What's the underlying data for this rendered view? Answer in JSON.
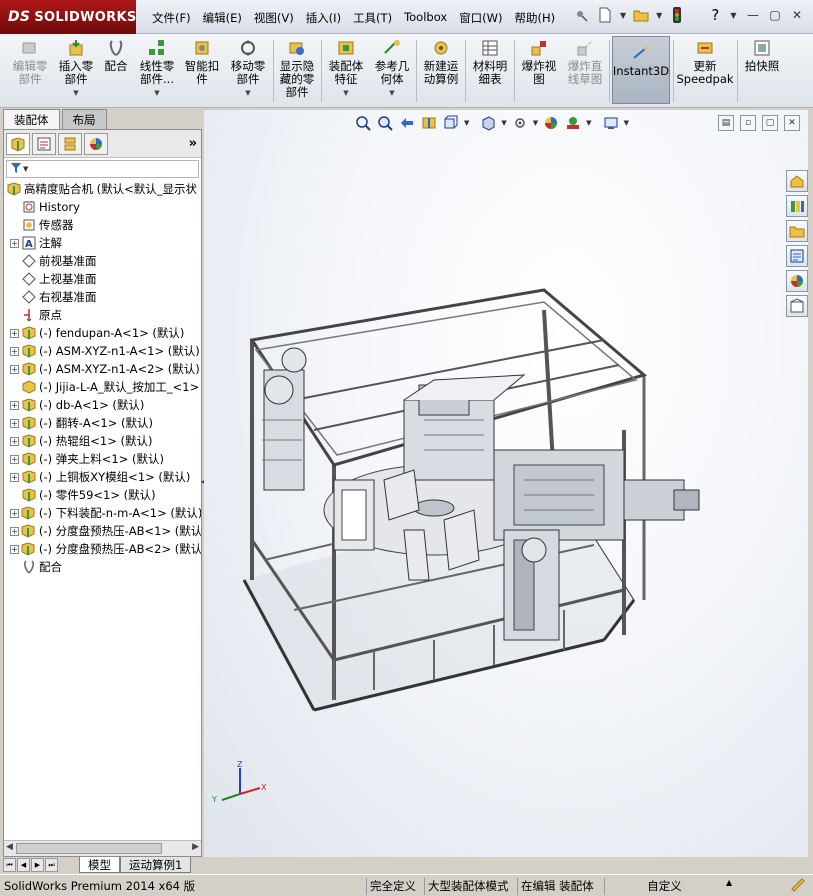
{
  "app": {
    "brand": "SOLIDWORKS",
    "brand_prefix": "DS"
  },
  "menu": [
    "文件(F)",
    "编辑(E)",
    "视图(V)",
    "插入(I)",
    "工具(T)",
    "Toolbox",
    "窗口(W)",
    "帮助(H)"
  ],
  "quick_access_icons": [
    "pin-icon",
    "new-document-icon",
    "open-folder-icon",
    "traffic-light-icon",
    "help-icon"
  ],
  "window_controls": [
    "minimize-icon",
    "restore-icon",
    "close-icon"
  ],
  "commands": [
    {
      "label": "编辑零\n部件",
      "icon": "edit-component-icon",
      "disabled": true,
      "dropdown": false
    },
    {
      "label": "插入零\n部件",
      "icon": "insert-component-icon",
      "disabled": false,
      "dropdown": true
    },
    {
      "label": "配合",
      "icon": "mate-icon",
      "disabled": false,
      "dropdown": false
    },
    {
      "label": "线性零\n部件...",
      "icon": "linear-pattern-icon",
      "disabled": false,
      "dropdown": true
    },
    {
      "label": "智能扣\n件",
      "icon": "smart-fastener-icon",
      "disabled": false,
      "dropdown": false
    },
    {
      "label": "移动零\n部件",
      "icon": "move-component-icon",
      "disabled": false,
      "dropdown": true
    },
    {
      "label": "显示隐\n藏的零\n部件",
      "icon": "show-hidden-icon",
      "disabled": false,
      "dropdown": false
    },
    {
      "label": "装配体\n特征",
      "icon": "assembly-feature-icon",
      "disabled": false,
      "dropdown": true
    },
    {
      "label": "参考几\n何体",
      "icon": "reference-geometry-icon",
      "disabled": false,
      "dropdown": true
    },
    {
      "label": "新建运\n动算例",
      "icon": "motion-study-icon",
      "disabled": false,
      "dropdown": false
    },
    {
      "label": "材料明\n细表",
      "icon": "bom-icon",
      "disabled": false,
      "dropdown": false
    },
    {
      "label": "爆炸视\n图",
      "icon": "exploded-view-icon",
      "disabled": false,
      "dropdown": false
    },
    {
      "label": "爆炸直\n线草图",
      "icon": "explode-line-sketch-icon",
      "disabled": true,
      "dropdown": false
    },
    {
      "label": "Instant3D",
      "icon": "instant3d-icon",
      "disabled": false,
      "dropdown": false
    },
    {
      "label": "更新\nSpeedpak",
      "icon": "speedpak-icon",
      "disabled": false,
      "dropdown": false
    },
    {
      "label": "拍快照",
      "icon": "snapshot-icon",
      "disabled": false,
      "dropdown": false
    }
  ],
  "left_tabs": [
    "装配体",
    "布局"
  ],
  "feature_tree": {
    "root": "高精度贴合机 (默认<默认_显示状",
    "nodes": [
      {
        "label": "History",
        "icon": "history-icon",
        "expand": "none"
      },
      {
        "label": "传感器",
        "icon": "sensor-icon",
        "expand": "none"
      },
      {
        "label": "注解",
        "icon": "annotation-icon",
        "expand": "+"
      },
      {
        "label": "前视基准面",
        "icon": "plane-icon",
        "expand": "none"
      },
      {
        "label": "上视基准面",
        "icon": "plane-icon",
        "expand": "none"
      },
      {
        "label": "右视基准面",
        "icon": "plane-icon",
        "expand": "none"
      },
      {
        "label": "原点",
        "icon": "origin-icon",
        "expand": "none"
      },
      {
        "label": "(-) fendupan-A<1> (默认)",
        "icon": "subassembly-icon",
        "expand": "+"
      },
      {
        "label": "(-) ASM-XYZ-n1-A<1> (默认)",
        "icon": "subassembly-icon",
        "expand": "+"
      },
      {
        "label": "(-) ASM-XYZ-n1-A<2> (默认)",
        "icon": "subassembly-icon",
        "expand": "+"
      },
      {
        "label": "(-) Jijia-L-A_默认_按加工_<1>",
        "icon": "part-icon",
        "expand": "none"
      },
      {
        "label": "(-) db-A<1> (默认)",
        "icon": "subassembly-icon",
        "expand": "+"
      },
      {
        "label": "(-) 翻转-A<1> (默认)",
        "icon": "subassembly-icon",
        "expand": "+"
      },
      {
        "label": "(-) 热辊组<1> (默认)",
        "icon": "subassembly-icon",
        "expand": "+"
      },
      {
        "label": "(-) 弹夹上料<1> (默认)",
        "icon": "subassembly-icon",
        "expand": "+"
      },
      {
        "label": "(-) 上铜板XY模组<1> (默认)",
        "icon": "subassembly-icon",
        "expand": "+"
      },
      {
        "label": "(-) 零件59<1> (默认)",
        "icon": "subassembly-icon",
        "expand": "none"
      },
      {
        "label": "(-) 下料装配-n-m-A<1> (默认)",
        "icon": "subassembly-icon",
        "expand": "+"
      },
      {
        "label": "(-) 分度盘预热压-AB<1> (默认",
        "icon": "subassembly-icon",
        "expand": "+"
      },
      {
        "label": "(-) 分度盘预热压-AB<2> (默认",
        "icon": "subassembly-icon",
        "expand": "+"
      },
      {
        "label": "配合",
        "icon": "mates-folder-icon",
        "expand": "none"
      }
    ]
  },
  "bottom_tabs": [
    "模型",
    "运动算例1"
  ],
  "status": {
    "product": "SolidWorks Premium 2014 x64 版",
    "fully_defined": "完全定义",
    "large_assembly": "大型装配体模式",
    "editing": "在编辑 装配体",
    "custom": "自定义"
  },
  "triad_axes": [
    "Y",
    "Z",
    "X"
  ]
}
